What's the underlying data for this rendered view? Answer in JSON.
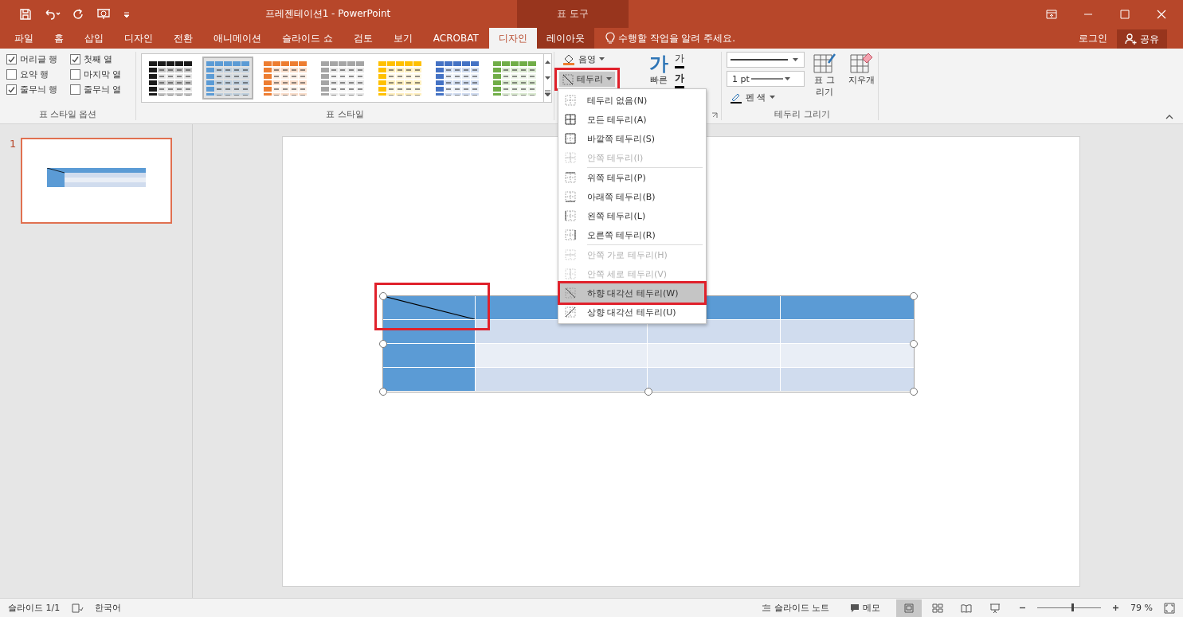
{
  "window": {
    "title": "프레젠테이션1 - PowerPoint",
    "context_title": "표 도구"
  },
  "tabs": [
    {
      "label": "파일",
      "selected": false,
      "contextual": false
    },
    {
      "label": "홈",
      "selected": false,
      "contextual": false
    },
    {
      "label": "삽입",
      "selected": false,
      "contextual": false
    },
    {
      "label": "디자인",
      "selected": false,
      "contextual": false
    },
    {
      "label": "전환",
      "selected": false,
      "contextual": false
    },
    {
      "label": "애니메이션",
      "selected": false,
      "contextual": false
    },
    {
      "label": "슬라이드 쇼",
      "selected": false,
      "contextual": false
    },
    {
      "label": "검토",
      "selected": false,
      "contextual": false
    },
    {
      "label": "보기",
      "selected": false,
      "contextual": false
    },
    {
      "label": "ACROBAT",
      "selected": false,
      "contextual": false
    },
    {
      "label": "디자인",
      "selected": true,
      "contextual": true
    },
    {
      "label": "레이아웃",
      "selected": false,
      "contextual": true
    }
  ],
  "tell_me": {
    "placeholder": "수행할 작업을 알려 주세요."
  },
  "account": {
    "sign_in": "로그인",
    "share": "공유"
  },
  "ribbon": {
    "style_options": {
      "label": "표 스타일 옵션",
      "options": [
        {
          "label": "머리글 행",
          "checked": true
        },
        {
          "label": "첫째 열",
          "checked": true
        },
        {
          "label": "요약 행",
          "checked": false
        },
        {
          "label": "마지막 열",
          "checked": false
        },
        {
          "label": "줄무늬 행",
          "checked": true
        },
        {
          "label": "줄무늬 열",
          "checked": false
        }
      ]
    },
    "table_styles": {
      "label": "표 스타일",
      "items": [
        {
          "color": "#1a1a1a",
          "selected": false
        },
        {
          "color": "#5b9bd5",
          "selected": true
        },
        {
          "color": "#ed7d31",
          "selected": false
        },
        {
          "color": "#a5a5a5",
          "selected": false
        },
        {
          "color": "#ffc000",
          "selected": false
        },
        {
          "color": "#4472c4",
          "selected": false
        },
        {
          "color": "#70ad47",
          "selected": false
        }
      ]
    },
    "shading": {
      "label": "음영"
    },
    "borders": {
      "label": "테두리",
      "highlighted": true
    },
    "wordart": {
      "quick_glyph": "가",
      "quick_label": "빠른",
      "fill_glyph": "가",
      "outline_glyph": "가"
    },
    "draw_borders": {
      "label": "테두리 그리기",
      "pen_weight": "1 pt",
      "pen_color": "펜 색",
      "draw_table": "표 그리기",
      "eraser": "지우개"
    }
  },
  "border_menu": {
    "groups": [
      [
        {
          "label": "테두리 없음(N)",
          "kind": "none",
          "disabled": false,
          "selected": false
        },
        {
          "label": "모든 테두리(A)",
          "kind": "all",
          "disabled": false,
          "selected": false
        },
        {
          "label": "바깥쪽 테두리(S)",
          "kind": "outside",
          "disabled": false,
          "selected": false
        },
        {
          "label": "안쪽 테두리(I)",
          "kind": "inside",
          "disabled": true,
          "selected": false
        }
      ],
      [
        {
          "label": "위쪽 테두리(P)",
          "kind": "top",
          "disabled": false,
          "selected": false
        },
        {
          "label": "아래쪽 테두리(B)",
          "kind": "bottom",
          "disabled": false,
          "selected": false
        },
        {
          "label": "왼쪽 테두리(L)",
          "kind": "left",
          "disabled": false,
          "selected": false
        },
        {
          "label": "오른쪽 테두리(R)",
          "kind": "right",
          "disabled": false,
          "selected": false
        }
      ],
      [
        {
          "label": "안쪽 가로 테두리(H)",
          "kind": "inside_h",
          "disabled": true,
          "selected": false
        },
        {
          "label": "안쪽 세로 테두리(V)",
          "kind": "inside_v",
          "disabled": true,
          "selected": false
        },
        {
          "label": "하향 대각선 테두리(W)",
          "kind": "diag_down",
          "disabled": false,
          "selected": true
        },
        {
          "label": "상향 대각선 테두리(U)",
          "kind": "diag_up",
          "disabled": false,
          "selected": false
        }
      ]
    ]
  },
  "slides_pane": {
    "slides": [
      {
        "number": "1",
        "selected": true
      }
    ]
  },
  "table": {
    "first_cell_highlighted": true,
    "rows": [
      {
        "kind": "header",
        "cells": [
          {
            "diagonal": true
          },
          {
            "diagonal": false
          },
          {
            "diagonal": false
          },
          {
            "diagonal": false
          }
        ]
      },
      {
        "kind": "band",
        "cells": [
          {
            "diagonal": false
          },
          {
            "diagonal": false
          },
          {
            "diagonal": false
          },
          {
            "diagonal": false
          }
        ]
      },
      {
        "kind": "plain",
        "cells": [
          {
            "diagonal": false
          },
          {
            "diagonal": false
          },
          {
            "diagonal": false
          },
          {
            "diagonal": false
          }
        ]
      },
      {
        "kind": "band",
        "cells": [
          {
            "diagonal": false
          },
          {
            "diagonal": false
          },
          {
            "diagonal": false
          },
          {
            "diagonal": false
          }
        ]
      }
    ]
  },
  "status_bar": {
    "slide": "슬라이드 1/1",
    "language": "한국어",
    "notes": "슬라이드 노트",
    "comments": "메모",
    "views": [
      {
        "kind": "normal",
        "selected": true
      },
      {
        "kind": "sorter",
        "selected": false
      },
      {
        "kind": "reading",
        "selected": false
      },
      {
        "kind": "show",
        "selected": false
      }
    ],
    "zoom": {
      "level": 0.55,
      "value": "79 %"
    }
  }
}
